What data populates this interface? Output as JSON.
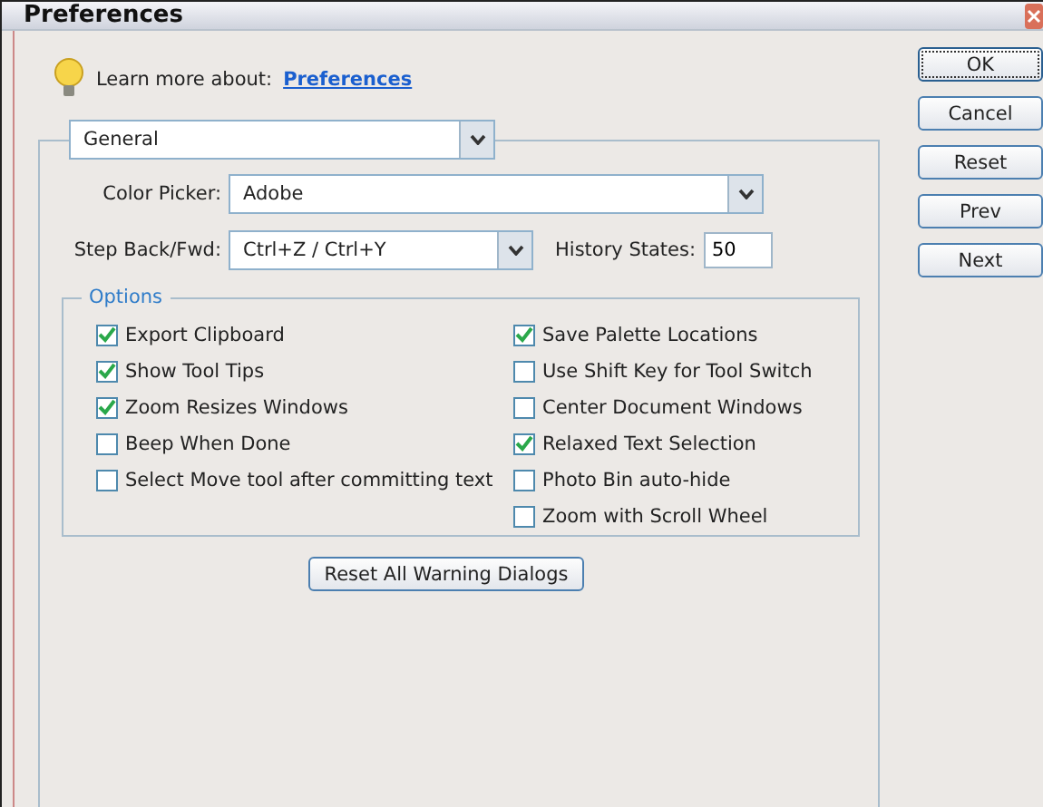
{
  "window": {
    "title": "Preferences"
  },
  "help": {
    "text": "Learn more about:",
    "link": "Preferences"
  },
  "section_dropdown": {
    "value": "General"
  },
  "color_picker": {
    "label": "Color Picker:",
    "value": "Adobe"
  },
  "step_back": {
    "label": "Step Back/Fwd:",
    "value": "Ctrl+Z / Ctrl+Y"
  },
  "history_states": {
    "label": "History States:",
    "value": "50"
  },
  "options": {
    "title": "Options",
    "left": [
      {
        "label": "Export Clipboard",
        "checked": true
      },
      {
        "label": "Show Tool Tips",
        "checked": true
      },
      {
        "label": "Zoom Resizes Windows",
        "checked": true
      },
      {
        "label": "Beep When Done",
        "checked": false
      },
      {
        "label": "Select Move tool after committing text",
        "checked": false
      }
    ],
    "right": [
      {
        "label": "Save Palette Locations",
        "checked": true
      },
      {
        "label": "Use Shift Key for Tool Switch",
        "checked": false
      },
      {
        "label": "Center Document Windows",
        "checked": false
      },
      {
        "label": "Relaxed Text Selection",
        "checked": true
      },
      {
        "label": "Photo Bin auto-hide",
        "checked": false
      },
      {
        "label": "Zoom with Scroll Wheel",
        "checked": false
      }
    ]
  },
  "reset_warnings": "Reset All Warning Dialogs",
  "buttons": [
    {
      "label": "OK",
      "default": true
    },
    {
      "label": "Cancel",
      "default": false
    },
    {
      "label": "Reset",
      "default": false
    },
    {
      "label": "Prev",
      "default": false
    },
    {
      "label": "Next",
      "default": false
    }
  ]
}
